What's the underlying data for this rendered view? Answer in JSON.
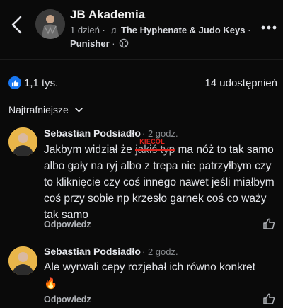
{
  "header": {
    "page_name": "JB Akademia",
    "age": "1 dzień",
    "separator": "·",
    "track": "The Hyphenate & Judo Keys",
    "track_suffix": "·",
    "track_line2": "Punisher",
    "line2_separator": "·",
    "icons": {
      "back": "chevron-left-icon",
      "more": "more-horizontal-icon",
      "music": "music-note-icon",
      "audience": "globe-icon"
    }
  },
  "stats": {
    "reactions": "1,1 tys.",
    "shares": "14 udostępnień",
    "reaction_icon": "like-icon",
    "accent": "#1877f2"
  },
  "sort": {
    "label": "Najtrafniejsze"
  },
  "comments": [
    {
      "author": "Sebastian Podsiadło",
      "time": "· 2 godz.",
      "text_before": "Jakbym widział że ",
      "struck_text": "jakiś typ",
      "overlay_label": "KIECOL",
      "text_after": " ma nóż to tak samo albo gały na ryj albo z trepa nie patrzyłbym czy to kliknięcie czy coś innego nawet jeśli miałbym coś przy sobie np krzesło garnek coś co waży tak samo",
      "reply": "Odpowiedz"
    },
    {
      "author": "Sebastian Podsiadło",
      "time": "· 2 godz.",
      "text": "Ale wyrwali cepy rozjebał ich równo konkret",
      "emoji": "🔥",
      "reply": "Odpowiedz"
    }
  ],
  "colors": {
    "background": "#0a0a0a",
    "text": "#e4e6eb",
    "secondary": "#b0b3b8",
    "strike": "#e0241c"
  }
}
